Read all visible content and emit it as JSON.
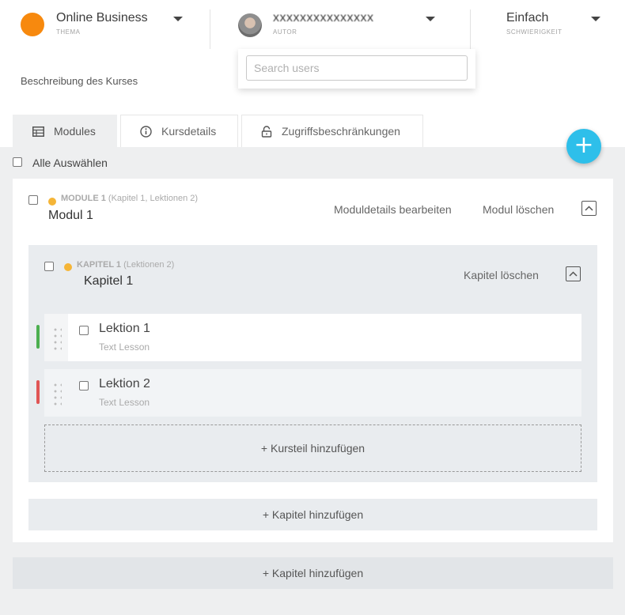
{
  "topbar": {
    "theme": {
      "value": "Online Business",
      "label": "THEMA",
      "color": "#f7890e"
    },
    "author": {
      "value": "xxxxxxxxxxxxxxx",
      "label": "AUTOR"
    },
    "difficulty": {
      "value": "Einfach",
      "label": "SCHWIERIGKEIT"
    }
  },
  "search": {
    "placeholder": "Search users",
    "value": ""
  },
  "course_description": "Beschreibung des Kurses",
  "tabs": [
    {
      "label": "Modules",
      "icon": "table-icon",
      "active": true
    },
    {
      "label": "Kursdetails",
      "icon": "info-icon",
      "active": false
    },
    {
      "label": "Zugriffsbeschränkungen",
      "icon": "lock-icon",
      "active": false
    }
  ],
  "fab": {
    "icon": "plus-icon",
    "text": "+",
    "color": "#2ebfea"
  },
  "select_all": "Alle Auswählen",
  "module": {
    "tag": "MODULE 1",
    "counts": "(Kapitel 1,  Lektionen 2)",
    "title": "Modul 1",
    "edit_label": "Moduldetails bearbeiten",
    "delete_label": "Modul löschen",
    "status_color": "#f5b537"
  },
  "chapter": {
    "tag": "KAPITEL 1",
    "counts": "(Lektionen 2)",
    "title": "Kapitel 1",
    "delete_label": "Kapitel löschen"
  },
  "lessons": [
    {
      "title": "Lektion 1",
      "type": "Text Lesson",
      "status_color": "#4caf50"
    },
    {
      "title": "Lektion 2",
      "type": "Text Lesson",
      "status_color": "#e05555"
    }
  ],
  "add_course_part": "+ Kursteil hinzufügen",
  "add_chapter_inner": "+ Kapitel hinzufügen",
  "add_chapter_outer": "+ Kapitel hinzufügen"
}
